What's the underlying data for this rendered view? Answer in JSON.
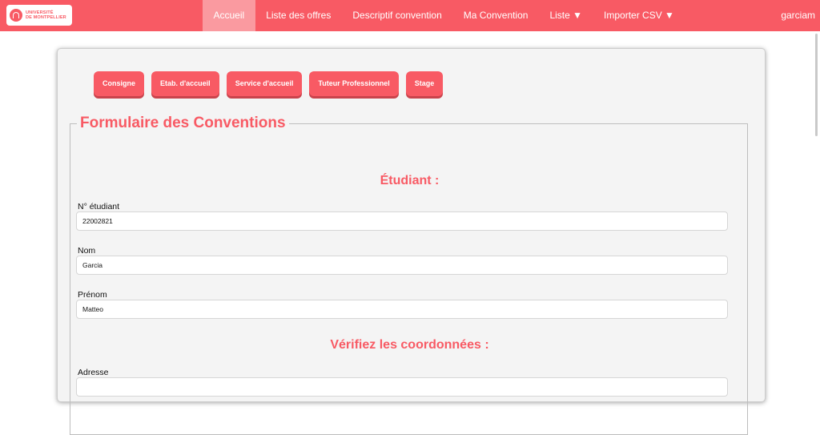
{
  "topnav": {
    "logo": {
      "line1": "UNIVERSITÉ",
      "line2": "DE MONTPELLIER"
    },
    "items": [
      {
        "label": "Accueil",
        "active": true
      },
      {
        "label": "Liste des offres"
      },
      {
        "label": "Descriptif convention"
      },
      {
        "label": "Ma Convention"
      },
      {
        "label": "Liste ▼"
      },
      {
        "label": "Importer CSV ▼"
      }
    ],
    "user": "garciam"
  },
  "tabs": [
    "Consigne",
    "Etab. d'accueil",
    "Service d'accueil",
    "Tuteur Professionnel",
    "Stage"
  ],
  "form": {
    "legend": "Formulaire des Conventions",
    "student_section_title": "Étudiant :",
    "fields": [
      {
        "label": "N° étudiant",
        "value": "22002821"
      },
      {
        "label": "Nom",
        "value": "Garcia"
      },
      {
        "label": "Prénom",
        "value": "Matteo"
      }
    ],
    "coords_section_title": "Vérifiez les coordonnées :",
    "address": {
      "label": "Adresse",
      "value": ""
    }
  },
  "colors": {
    "brand": "#f85a64",
    "nav_active": "#fa9aa0",
    "panel": "#f4f4f4"
  }
}
